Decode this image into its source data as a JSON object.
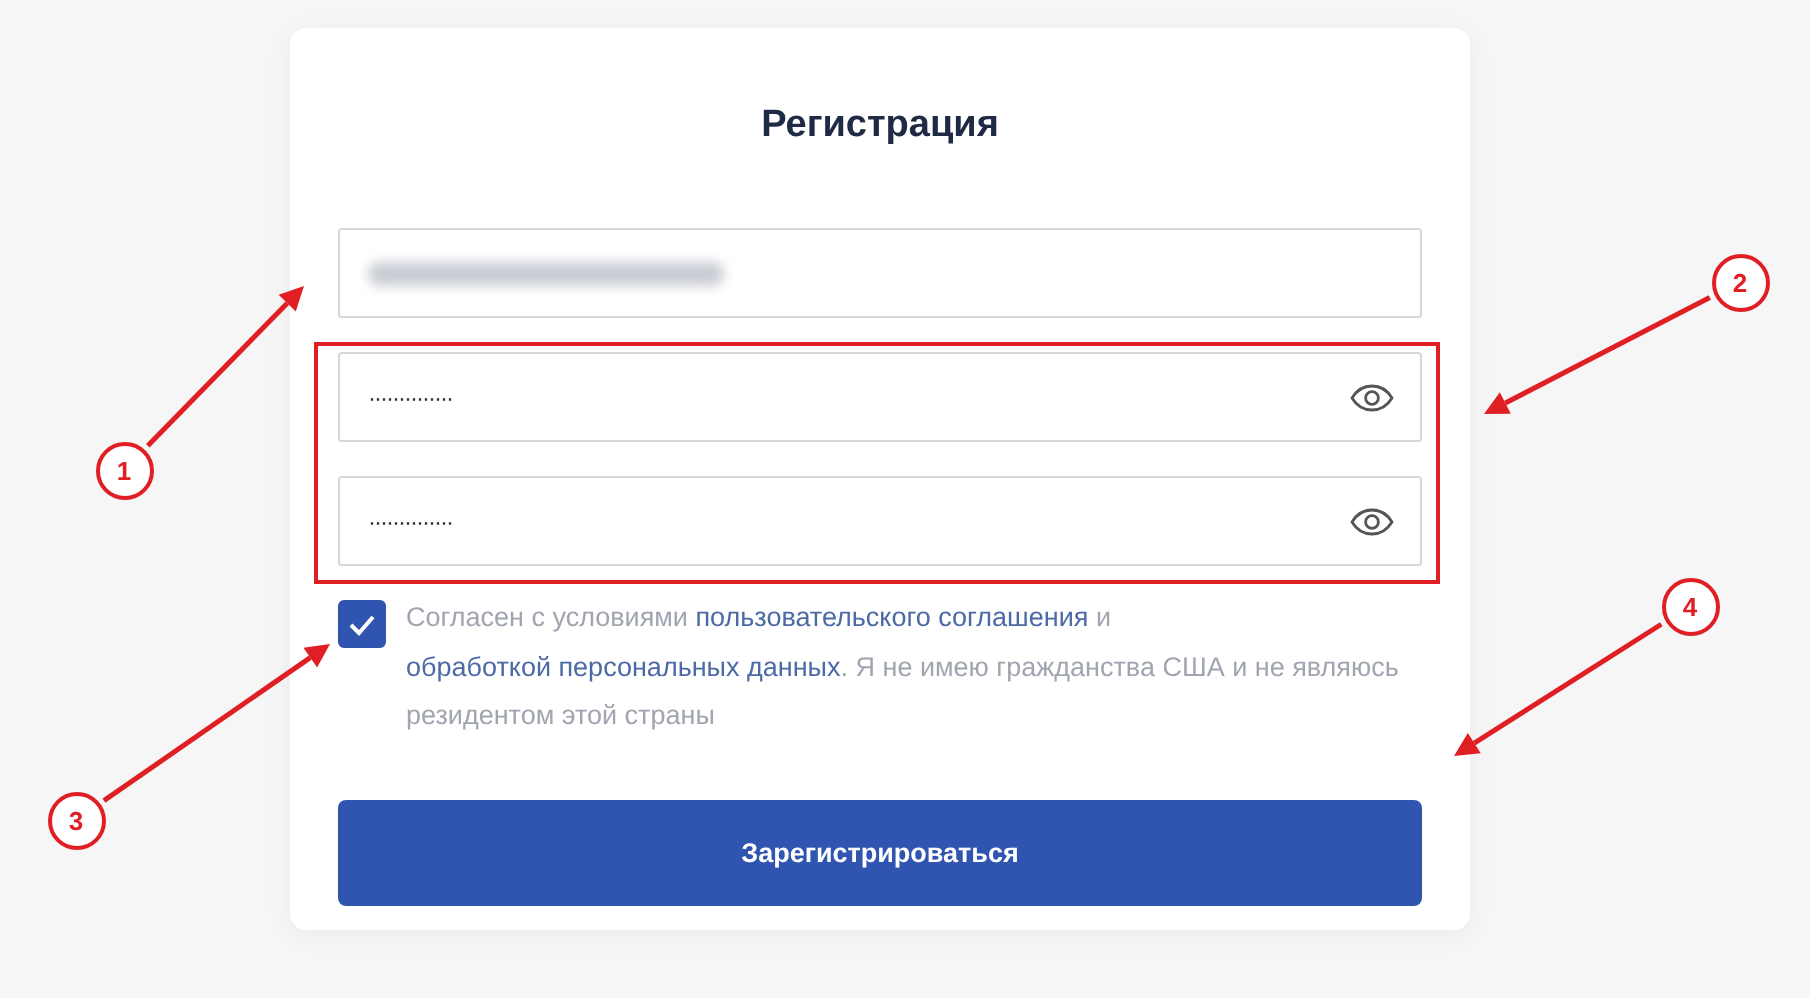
{
  "form": {
    "title": "Регистрация",
    "email_field": {
      "kind": "blurred"
    },
    "password_group": {
      "highlighted": true,
      "fields": [
        {
          "kind": "password",
          "value": "··············"
        },
        {
          "kind": "password",
          "value": "··············"
        }
      ]
    },
    "consent": {
      "checked": true,
      "parts": [
        {
          "kind": "text",
          "text": "Согласен с условиями "
        },
        {
          "kind": "link",
          "text": "пользовательского соглашения"
        },
        {
          "kind": "text",
          "text": " и "
        },
        {
          "kind": "link",
          "text": "обработкой персональных данных"
        },
        {
          "kind": "text",
          "text": ". Я не имею гражданства США и не являюсь резидентом этой страны"
        }
      ]
    },
    "submit": "Зарегистрироваться"
  },
  "annotations": [
    {
      "number": "1"
    },
    {
      "number": "2"
    },
    {
      "number": "3"
    },
    {
      "number": "4"
    }
  ]
}
